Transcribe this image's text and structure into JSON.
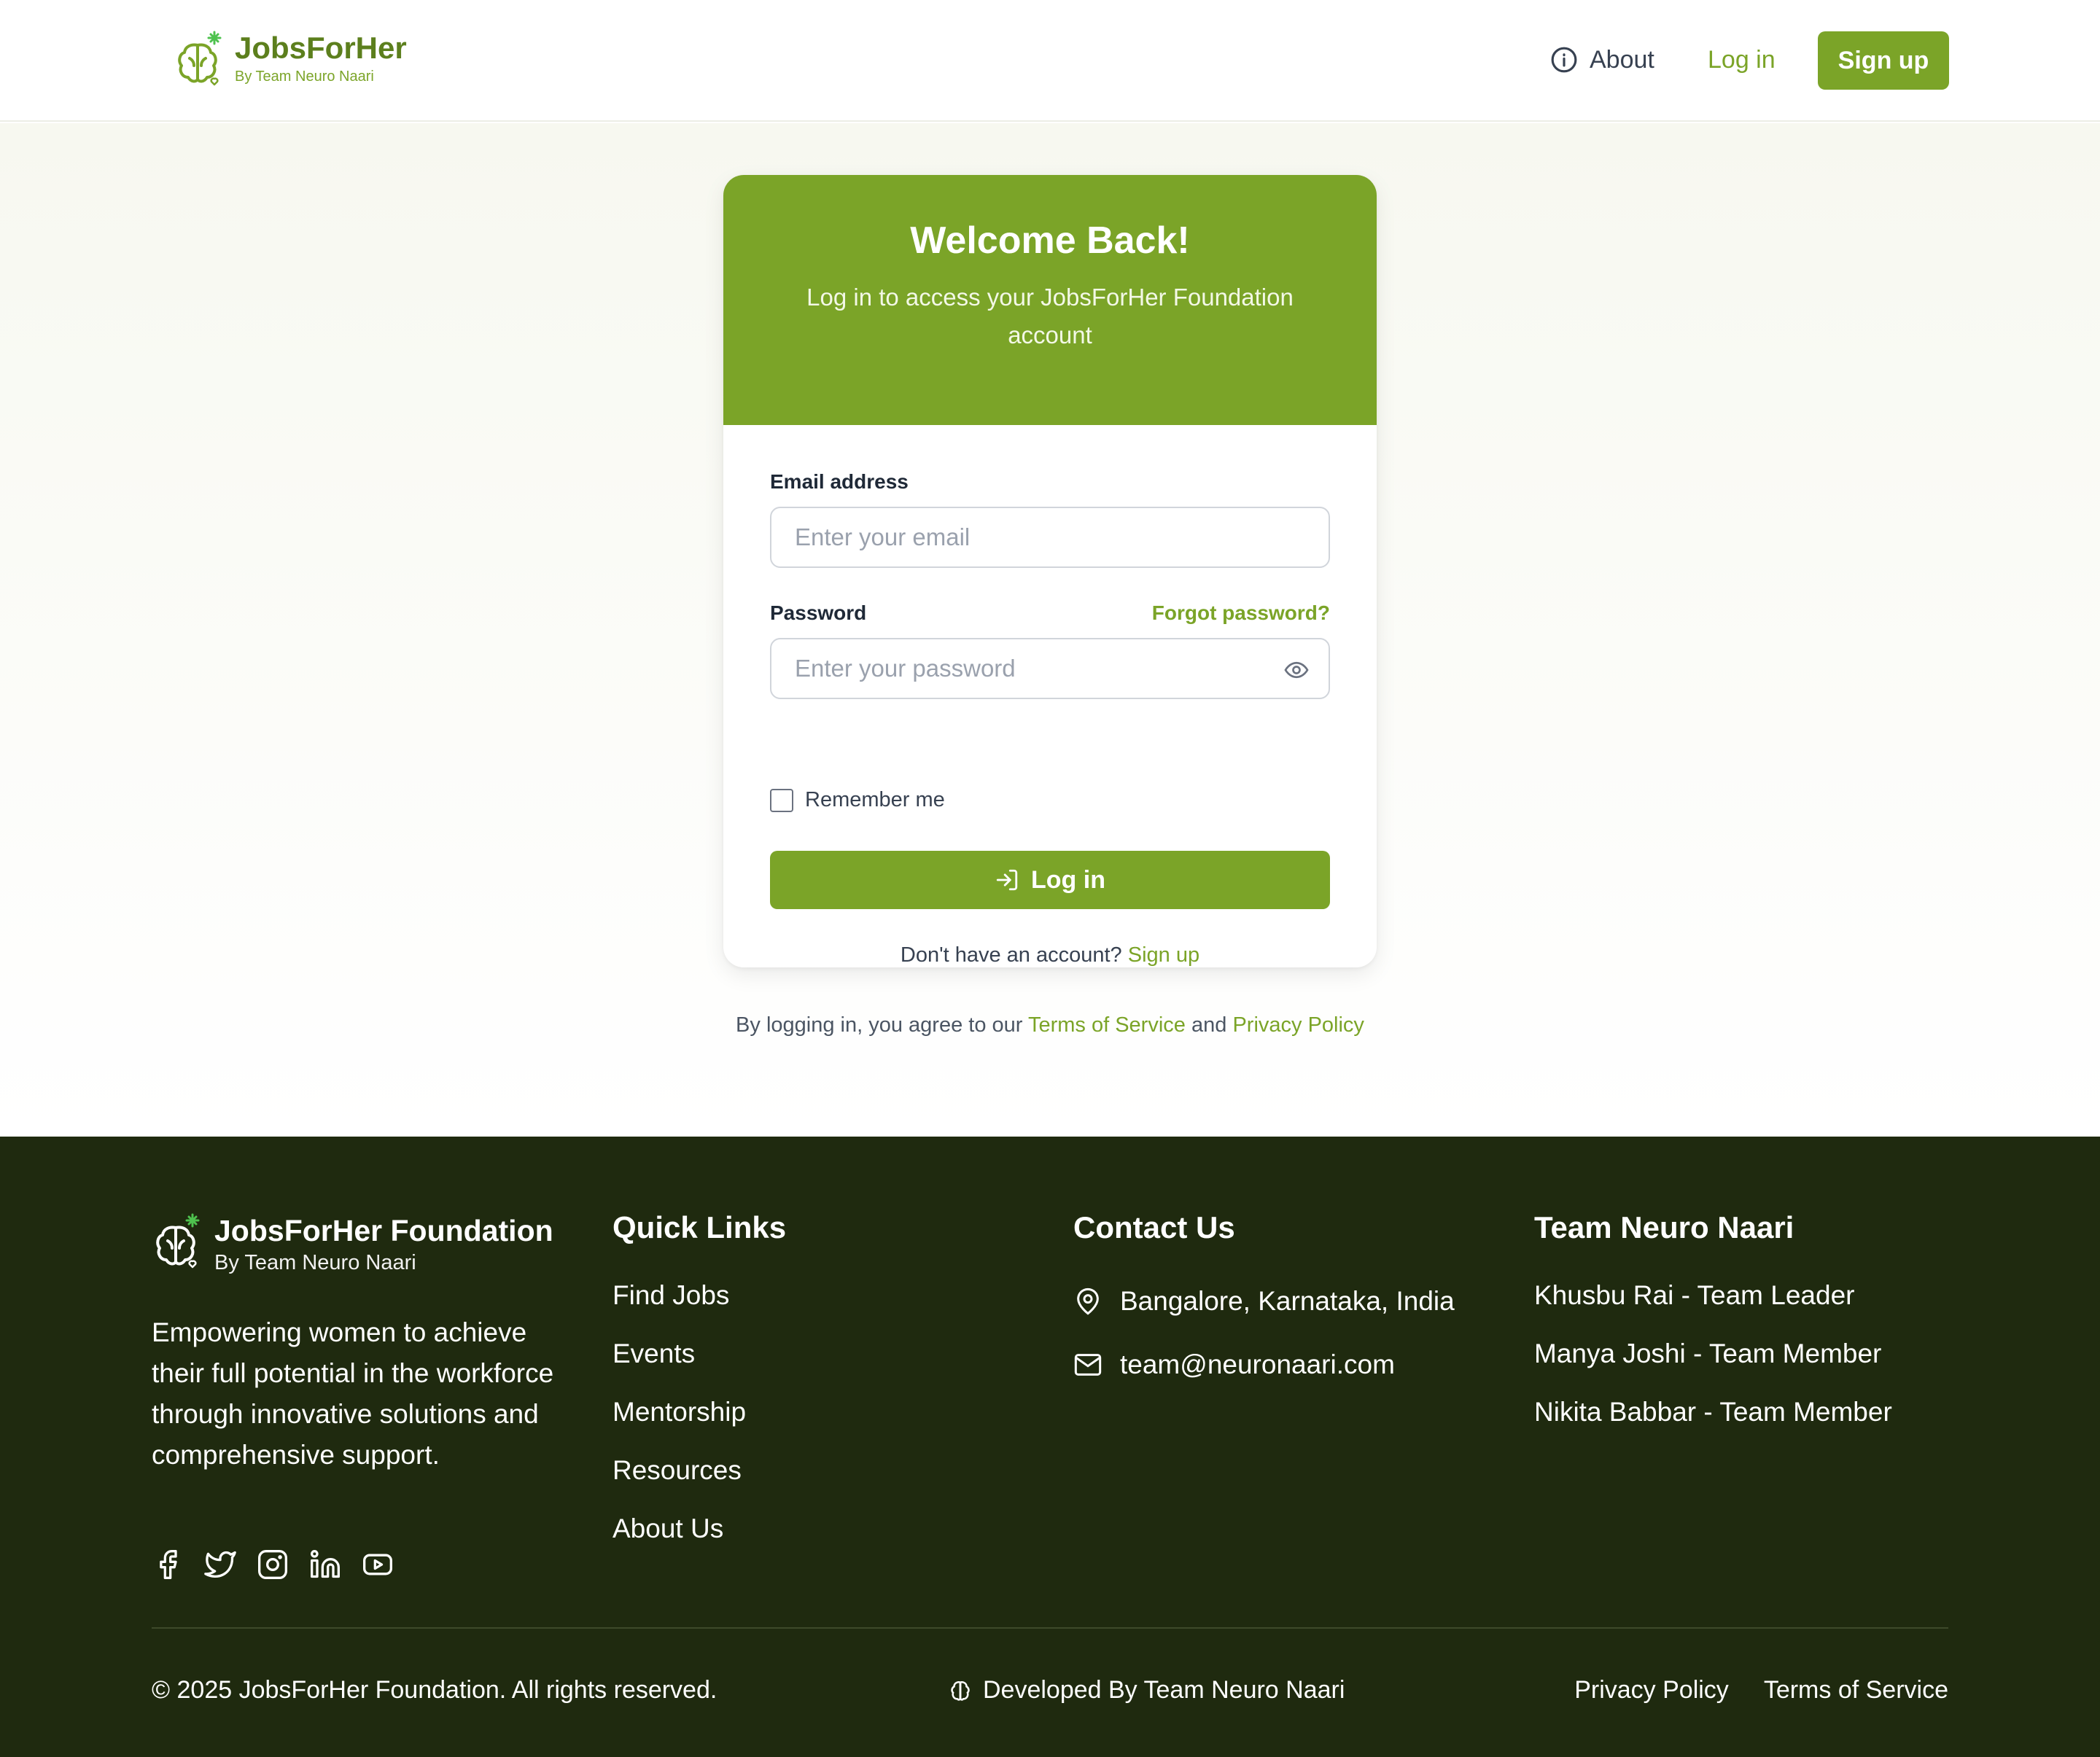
{
  "header": {
    "brand_title": "JobsForHer",
    "brand_sub": "By Team Neuro Naari",
    "nav_about": "About",
    "nav_login": "Log in",
    "nav_signup": "Sign up"
  },
  "login_card": {
    "title": "Welcome Back!",
    "subtitle": "Log in to access your JobsForHer Foundation account",
    "email_label": "Email address",
    "email_placeholder": "Enter your email",
    "password_label": "Password",
    "forgot": "Forgot password?",
    "password_placeholder": "Enter your password",
    "remember": "Remember me",
    "submit": "Log in",
    "no_account": "Don't have an account?",
    "signup_link": "Sign up"
  },
  "terms": {
    "prefix": "By logging in, you agree to our",
    "tos": "Terms of Service",
    "and": "and",
    "privacy": "Privacy Policy"
  },
  "footer": {
    "brand_title": "JobsForHer Foundation",
    "brand_sub": "By Team Neuro Naari",
    "description": "Empowering women to achieve their full potential in the workforce through innovative solutions and comprehensive support.",
    "socials": [
      "facebook-icon",
      "twitter-icon",
      "instagram-icon",
      "linkedin-icon",
      "youtube-icon"
    ],
    "quick_links_title": "Quick Links",
    "quick_links": [
      "Find Jobs",
      "Events",
      "Mentorship",
      "Resources",
      "About Us"
    ],
    "contact_title": "Contact Us",
    "contact_address": "Bangalore, Karnataka, India",
    "contact_email": "team@neuronaari.com",
    "team_title": "Team Neuro Naari",
    "team_members": [
      "Khusbu Rai - Team Leader",
      "Manya Joshi - Team Member",
      "Nikita Babbar - Team Member"
    ],
    "copyright": "© 2025 JobsForHer Foundation. All rights reserved.",
    "developed_by": "Developed By Team Neuro Naari",
    "privacy": "Privacy Policy",
    "tos": "Terms of Service"
  },
  "colors": {
    "accent": "#7ba428",
    "brand_dark": "#5c7f1d",
    "footer_bg": "#1f2a0f"
  }
}
